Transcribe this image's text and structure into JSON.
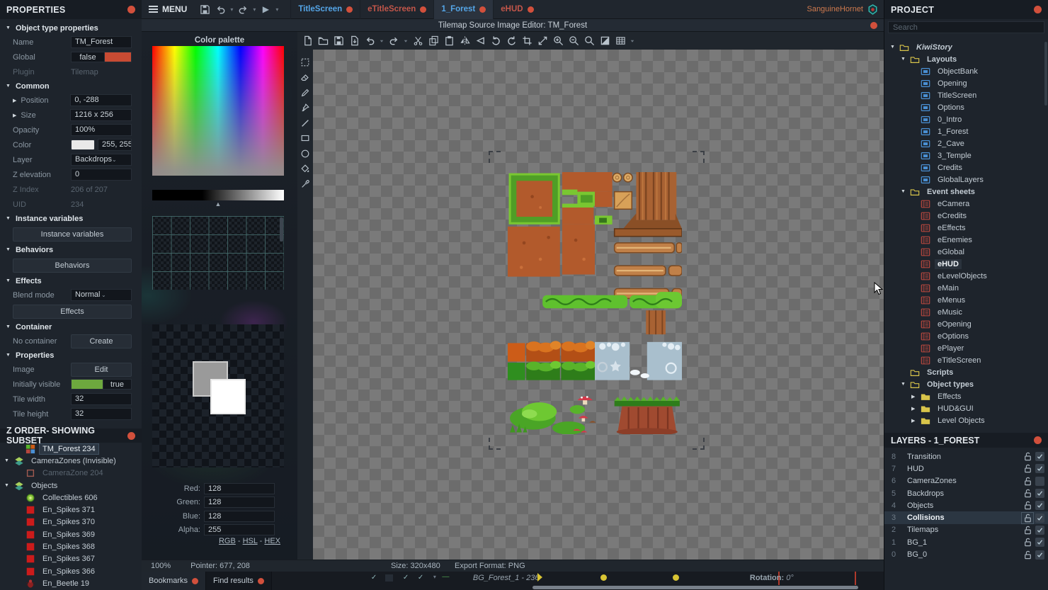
{
  "colors": {
    "accent_red": "#d2503c",
    "tab_blue": "#55a6e8",
    "tab_red": "#c3564a",
    "toggle_green": "#6da83e",
    "toggle_red": "#c94b33",
    "folder_yellow": "#d8c44a",
    "layout_blue": "#4a90d4",
    "sheet_red": "#b5473e",
    "keyframe_yellow": "#d8c434",
    "hex_teal": "#2fb6ac"
  },
  "menubar": {
    "menu_label": "MENU",
    "user": "SanguineHornet",
    "tabs": [
      {
        "label": "TitleScreen",
        "style": "blue",
        "active": false
      },
      {
        "label": "eTitleScreen",
        "style": "red",
        "active": false
      },
      {
        "label": "1_Forest",
        "style": "blue",
        "active": true
      },
      {
        "label": "eHUD",
        "style": "red",
        "active": false
      }
    ]
  },
  "props": {
    "title": "PROPERTIES",
    "sec_object": "Object type properties",
    "name_label": "Name",
    "name_value": "TM_Forest",
    "global_label": "Global",
    "global_value": "false",
    "plugin_label": "Plugin",
    "plugin_value": "Tilemap",
    "sec_common": "Common",
    "position_label": "Position",
    "position_value": "0, -288",
    "size_label": "Size",
    "size_value": "1216 x 256",
    "opacity_label": "Opacity",
    "opacity_value": "100%",
    "color_label": "Color",
    "color_value": "255, 255,",
    "layer_label": "Layer",
    "layer_value": "Backdrops",
    "zelev_label": "Z elevation",
    "zelev_value": "0",
    "zindex_label": "Z Index",
    "zindex_value": "206 of 207",
    "uid_label": "UID",
    "uid_value": "234",
    "sec_instvars": "Instance variables",
    "instvars_button": "Instance variables",
    "sec_behaviors": "Behaviors",
    "behaviors_button": "Behaviors",
    "sec_effects": "Effects",
    "blend_label": "Blend mode",
    "blend_value": "Normal",
    "effects_button": "Effects",
    "sec_container": "Container",
    "container_label": "No container",
    "container_button": "Create",
    "sec_properties": "Properties",
    "image_label": "Image",
    "image_button": "Edit",
    "initvis_label": "Initially visible",
    "initvis_value": "true",
    "tilew_label": "Tile width",
    "tilew_value": "32",
    "tileh_label": "Tile height",
    "tileh_value": "32"
  },
  "z_order": {
    "title": "Z ORDER- SHOWING SUBSET",
    "items": [
      {
        "label": "TM_Forest 234",
        "icon": "tilemap",
        "depth": 1,
        "selected": true
      },
      {
        "label": "CameraZones (Invisible)",
        "icon": "layers",
        "depth": 0,
        "arrow": true
      },
      {
        "label": "CameraZone 204",
        "icon": "zone",
        "depth": 1,
        "dim": true
      },
      {
        "label": "Objects",
        "icon": "layers",
        "depth": 0,
        "arrow": true
      },
      {
        "label": "Collectibles 606",
        "icon": "collect",
        "depth": 1
      },
      {
        "label": "En_Spikes 371",
        "icon": "redsq",
        "depth": 1
      },
      {
        "label": "En_Spikes 370",
        "icon": "redsq",
        "depth": 1
      },
      {
        "label": "En_Spikes 369",
        "icon": "redsq",
        "depth": 1
      },
      {
        "label": "En_Spikes 368",
        "icon": "redsq",
        "depth": 1
      },
      {
        "label": "En_Spikes 367",
        "icon": "redsq",
        "depth": 1
      },
      {
        "label": "En_Spikes 366",
        "icon": "redsq",
        "depth": 1
      },
      {
        "label": "En_Beetle 19",
        "icon": "beetle",
        "depth": 1
      }
    ]
  },
  "editor": {
    "title": "Tilemap Source Image Editor: TM_Forest",
    "palette": {
      "title": "Color palette",
      "fields": [
        {
          "label": "Red:",
          "value": "128"
        },
        {
          "label": "Green:",
          "value": "128"
        },
        {
          "label": "Blue:",
          "value": "128"
        },
        {
          "label": "Alpha:",
          "value": "255"
        }
      ],
      "mode_links": [
        "RGB",
        "HSL",
        "HEX"
      ]
    },
    "toolbar": [
      "new-file",
      "open-folder",
      "save",
      "save-as",
      "undo",
      "dropdown",
      "redo",
      "dropdown",
      "cut",
      "copy",
      "paste",
      "flip-horizontal",
      "flip-vertical",
      "rotate-ccw",
      "rotate-cw",
      "crop",
      "resize",
      "zoom-in",
      "zoom-out",
      "zoom-fit",
      "invert",
      "grid",
      "dropdown"
    ],
    "tools": [
      "marquee-select",
      "eraser",
      "pencil",
      "brush",
      "line",
      "rectangle",
      "ellipse",
      "fill-bucket",
      "eyedropper"
    ],
    "status": {
      "zoom": "100%",
      "pointer": "Pointer: 677, 208",
      "size": "Size: 320x480",
      "export": "Export Format: PNG"
    }
  },
  "project": {
    "title": "PROJECT",
    "search_placeholder": "Search",
    "tree": [
      {
        "label": "KiwiStory",
        "icon": "folder",
        "depth": 0,
        "arrow": "down",
        "bold": true,
        "italic": true
      },
      {
        "label": "Layouts",
        "icon": "folder",
        "depth": 1,
        "arrow": "down",
        "bold": true
      },
      {
        "label": "ObjectBank",
        "icon": "layout",
        "depth": 2
      },
      {
        "label": "Opening",
        "icon": "layout",
        "depth": 2
      },
      {
        "label": "TitleScreen",
        "icon": "layout",
        "depth": 2
      },
      {
        "label": "Options",
        "icon": "layout",
        "depth": 2
      },
      {
        "label": "0_Intro",
        "icon": "layout",
        "depth": 2
      },
      {
        "label": "1_Forest",
        "icon": "layout",
        "depth": 2
      },
      {
        "label": "2_Cave",
        "icon": "layout",
        "depth": 2
      },
      {
        "label": "3_Temple",
        "icon": "layout",
        "depth": 2
      },
      {
        "label": "Credits",
        "icon": "layout",
        "depth": 2
      },
      {
        "label": "GlobalLayers",
        "icon": "layout",
        "depth": 2
      },
      {
        "label": "Event sheets",
        "icon": "folder",
        "depth": 1,
        "arrow": "down",
        "bold": true
      },
      {
        "label": "eCamera",
        "icon": "sheet",
        "depth": 2
      },
      {
        "label": "eCredits",
        "icon": "sheet",
        "depth": 2
      },
      {
        "label": "eEffects",
        "icon": "sheet",
        "depth": 2
      },
      {
        "label": "eEnemies",
        "icon": "sheet",
        "depth": 2
      },
      {
        "label": "eGlobal",
        "icon": "sheet",
        "depth": 2
      },
      {
        "label": "eHUD",
        "icon": "sheet",
        "depth": 2,
        "selected": true
      },
      {
        "label": "eLevelObjects",
        "icon": "sheet",
        "depth": 2
      },
      {
        "label": "eMain",
        "icon": "sheet",
        "depth": 2
      },
      {
        "label": "eMenus",
        "icon": "sheet",
        "depth": 2
      },
      {
        "label": "eMusic",
        "icon": "sheet",
        "depth": 2
      },
      {
        "label": "eOpening",
        "icon": "sheet",
        "depth": 2
      },
      {
        "label": "eOptions",
        "icon": "sheet",
        "depth": 2
      },
      {
        "label": "ePlayer",
        "icon": "sheet",
        "depth": 2
      },
      {
        "label": "eTitleScreen",
        "icon": "sheet",
        "depth": 2
      },
      {
        "label": "Scripts",
        "icon": "folder",
        "depth": 1,
        "bold": true
      },
      {
        "label": "Object types",
        "icon": "folder",
        "depth": 1,
        "arrow": "down",
        "bold": true
      },
      {
        "label": "Effects",
        "icon": "foldersolid",
        "depth": 2,
        "arrow": "right"
      },
      {
        "label": "HUD&GUI",
        "icon": "foldersolid",
        "depth": 2,
        "arrow": "right"
      },
      {
        "label": "Level Objects",
        "icon": "foldersolid",
        "depth": 2,
        "arrow": "right"
      }
    ]
  },
  "layers": {
    "title": "LAYERS - 1_FOREST",
    "rows": [
      {
        "num": "8",
        "label": "Transition",
        "checked": true
      },
      {
        "num": "7",
        "label": "HUD",
        "checked": true
      },
      {
        "num": "6",
        "label": "CameraZones",
        "checked": false
      },
      {
        "num": "5",
        "label": "Backdrops",
        "checked": true
      },
      {
        "num": "4",
        "label": "Objects",
        "checked": true
      },
      {
        "num": "3",
        "label": "Collisions",
        "checked": true,
        "selected": true
      },
      {
        "num": "2",
        "label": "Tilemaps",
        "checked": true
      },
      {
        "num": "1",
        "label": "BG_1",
        "checked": true
      },
      {
        "num": "0",
        "label": "BG_0",
        "checked": true
      }
    ]
  },
  "bottombar": {
    "tabs": [
      {
        "label": "Bookmarks"
      },
      {
        "label": "Find results"
      }
    ],
    "timeline_track": "BG_Forest_1 - 236",
    "rotation_label": "Rotation:",
    "rotation_value": "0°"
  }
}
